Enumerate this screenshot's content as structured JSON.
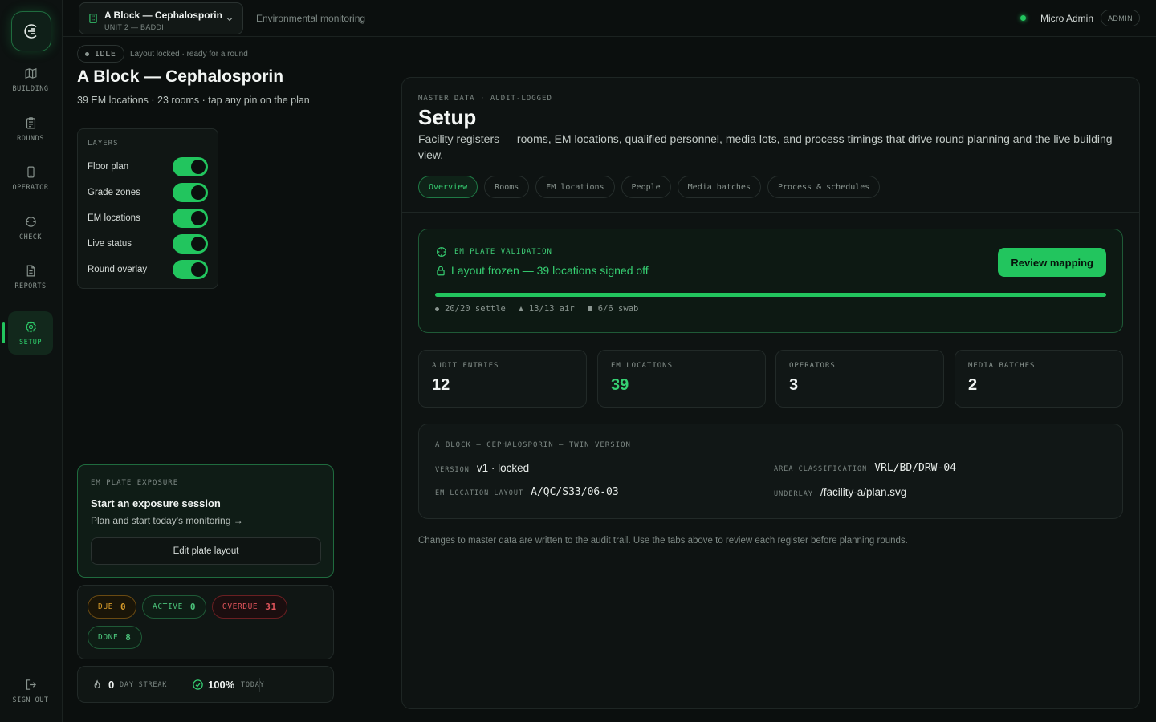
{
  "nav": {
    "items": [
      {
        "label": "BUILDING",
        "icon": "map-icon"
      },
      {
        "label": "ROUNDS",
        "icon": "clipboard-icon"
      },
      {
        "label": "OPERATOR",
        "icon": "phone-icon"
      },
      {
        "label": "CHECK",
        "icon": "crosshair-icon"
      },
      {
        "label": "REPORTS",
        "icon": "file-icon"
      },
      {
        "label": "SETUP",
        "icon": "gear-icon"
      }
    ],
    "active": "SETUP",
    "signout_label": "SIGN OUT"
  },
  "topbar": {
    "site_name": "A Block — Cephalosporin",
    "site_sub": "UNIT 2 — BADDI",
    "section_title": "Environmental monitoring",
    "user_name": "Micro Admin",
    "user_role": "ADMIN"
  },
  "left": {
    "state": "IDLE",
    "state_note": "Layout locked · ready for a round",
    "building_title": "A Block — Cephalosporin",
    "building_sub": "39 EM locations · 23 rooms · tap any pin on the plan",
    "layers": {
      "header": "LAYERS",
      "items": [
        {
          "label": "Floor plan",
          "on": true
        },
        {
          "label": "Grade zones",
          "on": true
        },
        {
          "label": "EM locations",
          "on": true
        },
        {
          "label": "Live status",
          "on": true
        },
        {
          "label": "Round overlay",
          "on": true
        }
      ]
    },
    "exposure": {
      "header": "EM PLATE EXPOSURE",
      "title": "Start an exposure session",
      "subtitle": "Plan and start today's monitoring →",
      "button": "Edit plate layout"
    },
    "counts": {
      "due": {
        "label": "DUE",
        "value": "0"
      },
      "active": {
        "label": "ACTIVE",
        "value": "0"
      },
      "overdue": {
        "label": "OVERDUE",
        "value": "31"
      },
      "done": {
        "label": "DONE",
        "value": "8"
      }
    },
    "streak": {
      "days": "0",
      "days_label": "DAY STREAK",
      "today": "100%",
      "today_label": "TODAY"
    }
  },
  "setup": {
    "eyebrow": "MASTER DATA · AUDIT-LOGGED",
    "title": "Setup",
    "description": "Facility registers — rooms, EM locations, qualified personnel, media lots, and process timings that drive round planning and the live building view.",
    "tabs": [
      "Overview",
      "Rooms",
      "EM locations",
      "People",
      "Media batches",
      "Process & schedules"
    ],
    "active_tab": "Overview",
    "validation": {
      "header": "EM PLATE VALIDATION",
      "message": "Layout frozen — 39 locations signed off",
      "button": "Review mapping",
      "progress": 1.0,
      "legend": [
        {
          "shape": "dot",
          "text": "20/20 settle"
        },
        {
          "shape": "triangle",
          "text": "13/13 air"
        },
        {
          "shape": "square",
          "text": "6/6 swab"
        }
      ]
    },
    "stats": [
      {
        "label": "AUDIT ENTRIES",
        "value": "12",
        "accent": false
      },
      {
        "label": "EM LOCATIONS",
        "value": "39",
        "accent": true
      },
      {
        "label": "OPERATORS",
        "value": "3",
        "accent": false
      },
      {
        "label": "MEDIA BATCHES",
        "value": "2",
        "accent": false
      }
    ],
    "twin": {
      "header": "A BLOCK — CEPHALOSPORIN — TWIN VERSION",
      "version_label": "VERSION",
      "version_value": "v1 · locked",
      "area_label": "AREA CLASSIFICATION",
      "area_value": "VRL/BD/DRW-04",
      "layout_label": "EM LOCATION LAYOUT",
      "layout_value": "A/QC/S33/06-03",
      "underlay_label": "UNDERLAY",
      "underlay_value": "/facility-a/plan.svg"
    },
    "footnote": "Changes to master data are written to the audit trail. Use the tabs above to review each register before planning rounds."
  },
  "colors": {
    "accent": "#22c55e",
    "warning": "#d79b2a",
    "danger": "#e2555c",
    "background": "#0b0f0e"
  }
}
